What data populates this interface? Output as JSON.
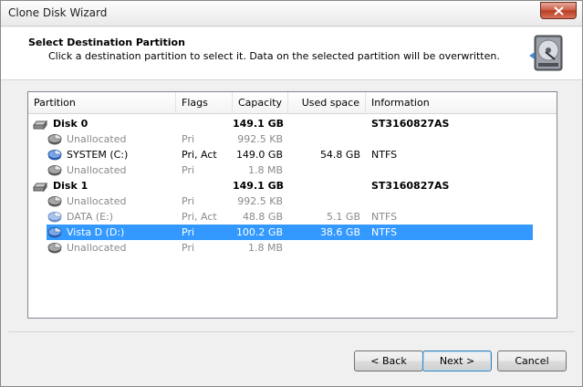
{
  "window": {
    "title": "Clone Disk Wizard"
  },
  "header": {
    "title": "Select Destination Partition",
    "subtitle": "Click a destination partition to select it. Data on the selected partition will be overwritten.",
    "icon": "hard-disk-icon"
  },
  "columns": {
    "partition": "Partition",
    "flags": "Flags",
    "capacity": "Capacity",
    "used": "Used space",
    "info": "Information"
  },
  "rows": [
    {
      "kind": "disk",
      "name": "Disk 0",
      "flags": "",
      "capacity": "149.1 GB",
      "used": "",
      "info": "ST3160827AS"
    },
    {
      "kind": "unalloc",
      "name": "Unallocated",
      "flags": "Pri",
      "capacity": "992.5 KB",
      "used": "",
      "info": ""
    },
    {
      "kind": "part",
      "name": "SYSTEM (C:)",
      "flags": "Pri, Act",
      "capacity": "149.0 GB",
      "used": "54.8 GB",
      "info": "NTFS"
    },
    {
      "kind": "unalloc",
      "name": "Unallocated",
      "flags": "Pri",
      "capacity": "1.8 MB",
      "used": "",
      "info": ""
    },
    {
      "kind": "disk",
      "name": "Disk 1",
      "flags": "",
      "capacity": "149.1 GB",
      "used": "",
      "info": "ST3160827AS"
    },
    {
      "kind": "unalloc",
      "name": "Unallocated",
      "flags": "Pri",
      "capacity": "992.5 KB",
      "used": "",
      "info": ""
    },
    {
      "kind": "part-dim",
      "name": "DATA (E:)",
      "flags": "Pri, Act",
      "capacity": "48.8 GB",
      "used": "5.1 GB",
      "info": "NTFS"
    },
    {
      "kind": "part",
      "name": "Vista D (D:)",
      "flags": "Pri",
      "capacity": "100.2 GB",
      "used": "38.6 GB",
      "info": "NTFS",
      "selected": true
    },
    {
      "kind": "unalloc",
      "name": "Unallocated",
      "flags": "Pri",
      "capacity": "1.8 MB",
      "used": "",
      "info": ""
    }
  ],
  "buttons": {
    "back": "< Back",
    "next": "Next >",
    "cancel": "Cancel"
  },
  "colors": {
    "selection": "#3399ff",
    "muted_text": "#8a8a8a"
  }
}
